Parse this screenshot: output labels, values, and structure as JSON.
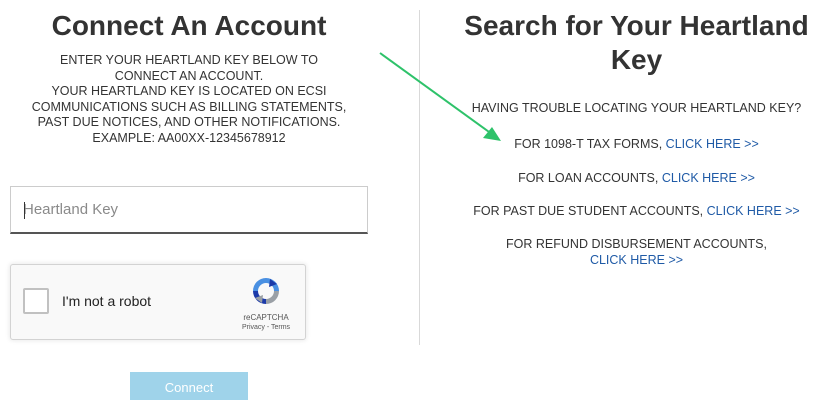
{
  "left": {
    "title": "Connect An Account",
    "instructions": [
      "ENTER YOUR HEARTLAND KEY BELOW TO",
      "CONNECT AN ACCOUNT.",
      "YOUR HEARTLAND KEY IS LOCATED ON ECSI",
      "COMMUNICATIONS SUCH AS BILLING STATEMENTS,",
      "PAST DUE NOTICES, AND OTHER NOTIFICATIONS.",
      "EXAMPLE: AA00XX-12345678912"
    ],
    "key_input": {
      "placeholder": "Heartland Key",
      "value": ""
    },
    "recaptcha": {
      "label": "I'm not a robot",
      "brand": "reCAPTCHA",
      "terms": "Privacy - Terms",
      "checked": false
    },
    "connect_button": "Connect"
  },
  "right": {
    "title_line1": "Search for Your Heartland",
    "title_line2": "Key",
    "trouble_text": "HAVING TROUBLE LOCATING YOUR HEARTLAND KEY?",
    "links": [
      {
        "prefix": "FOR 1098-T TAX FORMS, ",
        "link": "CLICK HERE >>"
      },
      {
        "prefix": "FOR LOAN ACCOUNTS, ",
        "link": "CLICK HERE >>"
      },
      {
        "prefix": "FOR PAST DUE STUDENT ACCOUNTS, ",
        "link": "CLICK HERE >>"
      },
      {
        "prefix": "FOR REFUND DISBURSEMENT ACCOUNTS,",
        "link": "CLICK HERE >>"
      }
    ]
  },
  "colors": {
    "text": "#333333",
    "link": "#1f5aa6",
    "button_disabled": "#9fd3ea",
    "annotation_arrow": "#2ec26a"
  },
  "icons": {
    "recaptcha_logo": "recaptcha-icon",
    "annotation": "green-arrow-icon"
  }
}
